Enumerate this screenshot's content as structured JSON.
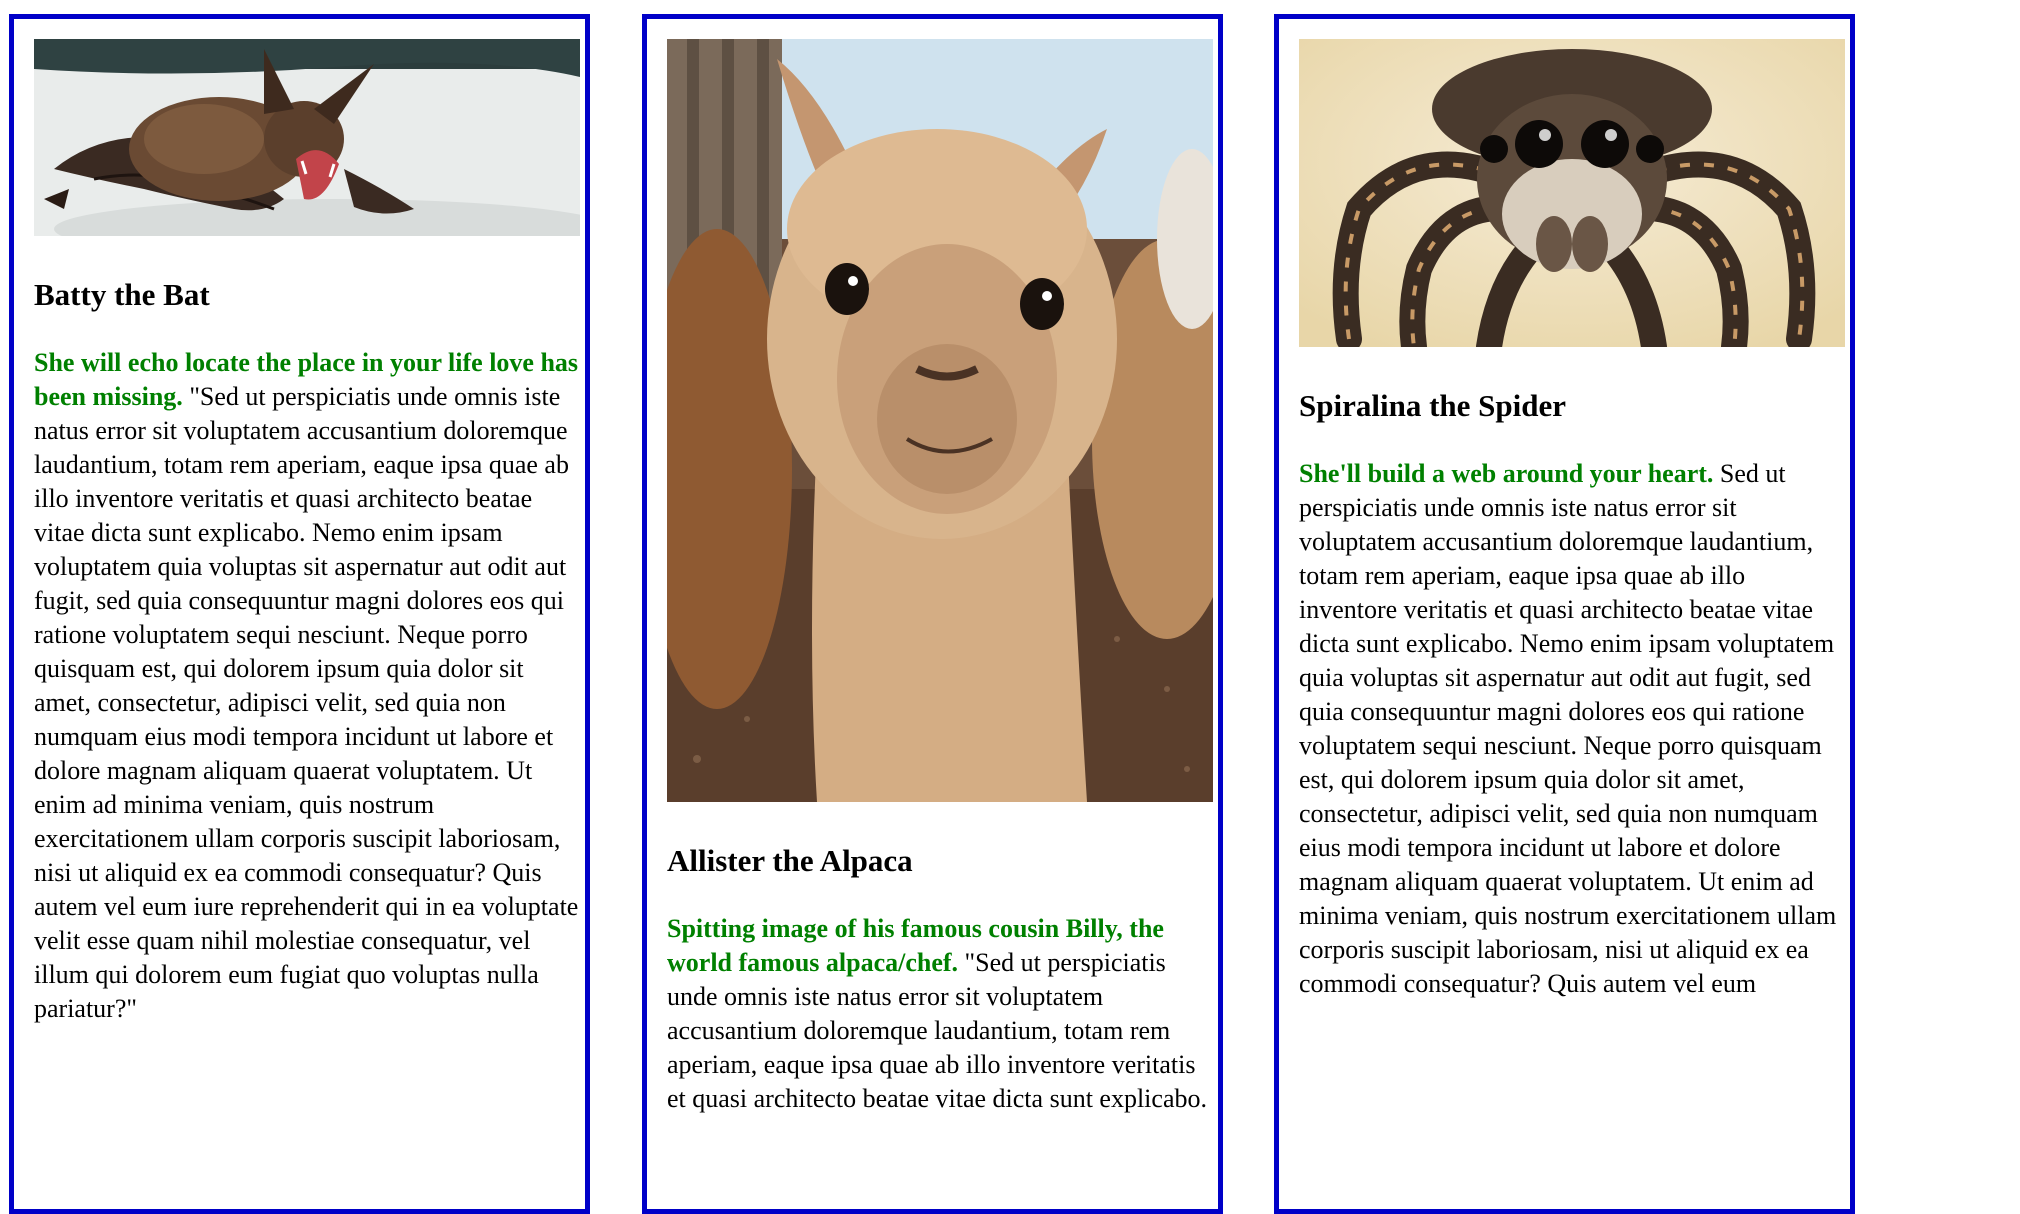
{
  "cards": [
    {
      "title": "Batty the Bat",
      "tagline": "She will echo locate the place in your life love has been missing.",
      "body": " \"Sed ut perspiciatis unde omnis iste natus error sit voluptatem accusantium doloremque laudantium, totam rem aperiam, eaque ipsa quae ab illo inventore veritatis et quasi architecto beatae vitae dicta sunt explicabo. Nemo enim ipsam voluptatem quia voluptas sit aspernatur aut odit aut fugit, sed quia consequuntur magni dolores eos qui ratione voluptatem sequi nesciunt. Neque porro quisquam est, qui dolorem ipsum quia dolor sit amet, consectetur, adipisci velit, sed quia non numquam eius modi tempora incidunt ut labore et dolore magnam aliquam quaerat voluptatem. Ut enim ad minima veniam, quis nostrum exercitationem ullam corporis suscipit laboriosam, nisi ut aliquid ex ea commodi consequatur? Quis autem vel eum iure reprehenderit qui in ea voluptate velit esse quam nihil molestiae consequatur, vel illum qui dolorem eum fugiat quo voluptas nulla pariatur?\""
    },
    {
      "title": "Allister the Alpaca",
      "tagline": "Spitting image of his famous cousin Billy, the world famous alpaca/chef.",
      "body": " \"Sed ut perspiciatis unde omnis iste natus error sit voluptatem accusantium doloremque laudantium, totam rem aperiam, eaque ipsa quae ab illo inventore veritatis et quasi architecto beatae vitae dicta sunt explicabo."
    },
    {
      "title": "Spiralina the Spider",
      "tagline": "She'll build a web around your heart.",
      "body": " Sed ut perspiciatis unde omnis iste natus error sit voluptatem accusantium doloremque laudantium, totam rem aperiam, eaque ipsa quae ab illo inventore veritatis et quasi architecto beatae vitae dicta sunt explicabo. Nemo enim ipsam voluptatem quia voluptas sit aspernatur aut odit aut fugit, sed quia consequuntur magni dolores eos qui ratione voluptatem sequi nesciunt. Neque porro quisquam est, qui dolorem ipsum quia dolor sit amet, consectetur, adipisci velit, sed quia non numquam eius modi tempora incidunt ut labore et dolore magnam aliquam quaerat voluptatem. Ut enim ad minima veniam, quis nostrum exercitationem ullam corporis suscipit laboriosam, nisi ut aliquid ex ea commodi consequatur? Quis autem vel eum"
    }
  ],
  "colors": {
    "border": "#0000c8",
    "tagline": "#008000"
  },
  "images": [
    "bat-photo",
    "alpaca-photo",
    "spider-photo"
  ]
}
